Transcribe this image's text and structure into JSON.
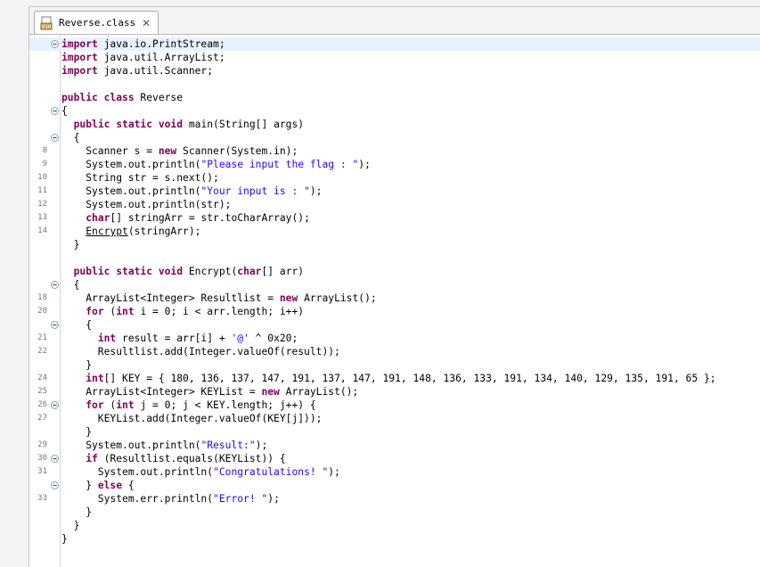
{
  "tab": {
    "title": "Reverse.class",
    "icon": "class-file-icon",
    "close_glyph": "✕"
  },
  "colors": {
    "keyword": "#7f0055",
    "string": "#2a00ff",
    "current_line": "#e8f2fe",
    "line_number": "#787878"
  },
  "lines": [
    {
      "fold": "minus",
      "current": true,
      "tokens": [
        [
          "kw",
          "import"
        ],
        [
          "t",
          " java.io.PrintStream;"
        ]
      ]
    },
    {
      "tokens": [
        [
          "kw",
          "import"
        ],
        [
          "t",
          " java.util.ArrayList;"
        ]
      ]
    },
    {
      "tokens": [
        [
          "kw",
          "import"
        ],
        [
          "t",
          " java.util.Scanner;"
        ]
      ]
    },
    {
      "tokens": []
    },
    {
      "tokens": [
        [
          "kw",
          "public class"
        ],
        [
          "t",
          " Reverse"
        ]
      ]
    },
    {
      "fold": "minus",
      "tokens": [
        [
          "t",
          "{"
        ]
      ]
    },
    {
      "tokens": [
        [
          "t",
          "  "
        ],
        [
          "kw",
          "public static void"
        ],
        [
          "t",
          " main(String[] args)"
        ]
      ]
    },
    {
      "fold": "minus",
      "tokens": [
        [
          "t",
          "  {"
        ]
      ]
    },
    {
      "ln": "8",
      "tokens": [
        [
          "t",
          "    Scanner s = "
        ],
        [
          "kw",
          "new"
        ],
        [
          "t",
          " Scanner(System.in);"
        ]
      ]
    },
    {
      "ln": "9",
      "tokens": [
        [
          "t",
          "    System.out.println("
        ],
        [
          "str",
          "\"Please input the flag : \""
        ],
        [
          "t",
          ");"
        ]
      ]
    },
    {
      "ln": "10",
      "tokens": [
        [
          "t",
          "    String str = s.next();"
        ]
      ]
    },
    {
      "ln": "11",
      "tokens": [
        [
          "t",
          "    System.out.println("
        ],
        [
          "str",
          "\"Your input is : \""
        ],
        [
          "t",
          ");"
        ]
      ]
    },
    {
      "ln": "12",
      "tokens": [
        [
          "t",
          "    System.out.println(str);"
        ]
      ]
    },
    {
      "ln": "13",
      "tokens": [
        [
          "t",
          "    "
        ],
        [
          "kw",
          "char"
        ],
        [
          "t",
          "[] stringArr = str.toCharArray();"
        ]
      ]
    },
    {
      "ln": "14",
      "tokens": [
        [
          "t",
          "    "
        ],
        [
          "ul",
          "Encrypt"
        ],
        [
          "t",
          "(stringArr);"
        ]
      ]
    },
    {
      "tokens": [
        [
          "t",
          "  }"
        ]
      ]
    },
    {
      "tokens": []
    },
    {
      "tokens": [
        [
          "t",
          "  "
        ],
        [
          "kw",
          "public static void"
        ],
        [
          "t",
          " Encrypt("
        ],
        [
          "kw",
          "char"
        ],
        [
          "t",
          "[] arr)"
        ]
      ]
    },
    {
      "fold": "minus",
      "tokens": [
        [
          "t",
          "  {"
        ]
      ]
    },
    {
      "ln": "18",
      "tokens": [
        [
          "t",
          "    ArrayList<Integer> Resultlist = "
        ],
        [
          "kw",
          "new"
        ],
        [
          "t",
          " ArrayList();"
        ]
      ]
    },
    {
      "ln": "20",
      "tokens": [
        [
          "t",
          "    "
        ],
        [
          "kw",
          "for"
        ],
        [
          "t",
          " ("
        ],
        [
          "kw",
          "int"
        ],
        [
          "t",
          " i = 0; i < arr.length; i++)"
        ]
      ]
    },
    {
      "fold": "minus",
      "tokens": [
        [
          "t",
          "    {"
        ]
      ]
    },
    {
      "ln": "21",
      "tokens": [
        [
          "t",
          "      "
        ],
        [
          "kw",
          "int"
        ],
        [
          "t",
          " result = arr[i] + "
        ],
        [
          "str",
          "'@'"
        ],
        [
          "t",
          " ^ 0x20;"
        ]
      ]
    },
    {
      "ln": "22",
      "tokens": [
        [
          "t",
          "      Resultlist.add(Integer.valueOf(result));"
        ]
      ]
    },
    {
      "tokens": [
        [
          "t",
          "    }"
        ]
      ]
    },
    {
      "ln": "24",
      "tokens": [
        [
          "t",
          "    "
        ],
        [
          "kw",
          "int"
        ],
        [
          "t",
          "[] KEY = { 180, 136, 137, 147, 191, 137, 147, 191, 148, 136, 133, 191, 134, 140, 129, 135, 191, 65 };"
        ]
      ]
    },
    {
      "ln": "25",
      "tokens": [
        [
          "t",
          "    ArrayList<Integer> KEYList = "
        ],
        [
          "kw",
          "new"
        ],
        [
          "t",
          " ArrayList();"
        ]
      ]
    },
    {
      "ln": "26",
      "fold": "minus",
      "tokens": [
        [
          "t",
          "    "
        ],
        [
          "kw",
          "for"
        ],
        [
          "t",
          " ("
        ],
        [
          "kw",
          "int"
        ],
        [
          "t",
          " j = 0; j < KEY.length; j++) {"
        ]
      ]
    },
    {
      "ln": "27",
      "tokens": [
        [
          "t",
          "      KEYList.add(Integer.valueOf(KEY[j]));"
        ]
      ]
    },
    {
      "tokens": [
        [
          "t",
          "    }"
        ]
      ]
    },
    {
      "ln": "29",
      "tokens": [
        [
          "t",
          "    System.out.println("
        ],
        [
          "str",
          "\"Result:\""
        ],
        [
          "t",
          ");"
        ]
      ]
    },
    {
      "ln": "30",
      "fold": "minus",
      "tokens": [
        [
          "t",
          "    "
        ],
        [
          "kw",
          "if"
        ],
        [
          "t",
          " (Resultlist.equals(KEYList)) {"
        ]
      ]
    },
    {
      "ln": "31",
      "tokens": [
        [
          "t",
          "      System.out.println("
        ],
        [
          "str",
          "\"Congratulations! \""
        ],
        [
          "t",
          ");"
        ]
      ]
    },
    {
      "fold": "minus",
      "tokens": [
        [
          "t",
          "    } "
        ],
        [
          "kw",
          "else"
        ],
        [
          "t",
          " {"
        ]
      ]
    },
    {
      "ln": "33",
      "tokens": [
        [
          "t",
          "      System.err.println("
        ],
        [
          "str",
          "\"Error! \""
        ],
        [
          "t",
          ");"
        ]
      ]
    },
    {
      "tokens": [
        [
          "t",
          "    }"
        ]
      ]
    },
    {
      "tokens": [
        [
          "t",
          "  }"
        ]
      ]
    },
    {
      "tokens": [
        [
          "t",
          "}"
        ]
      ]
    }
  ]
}
